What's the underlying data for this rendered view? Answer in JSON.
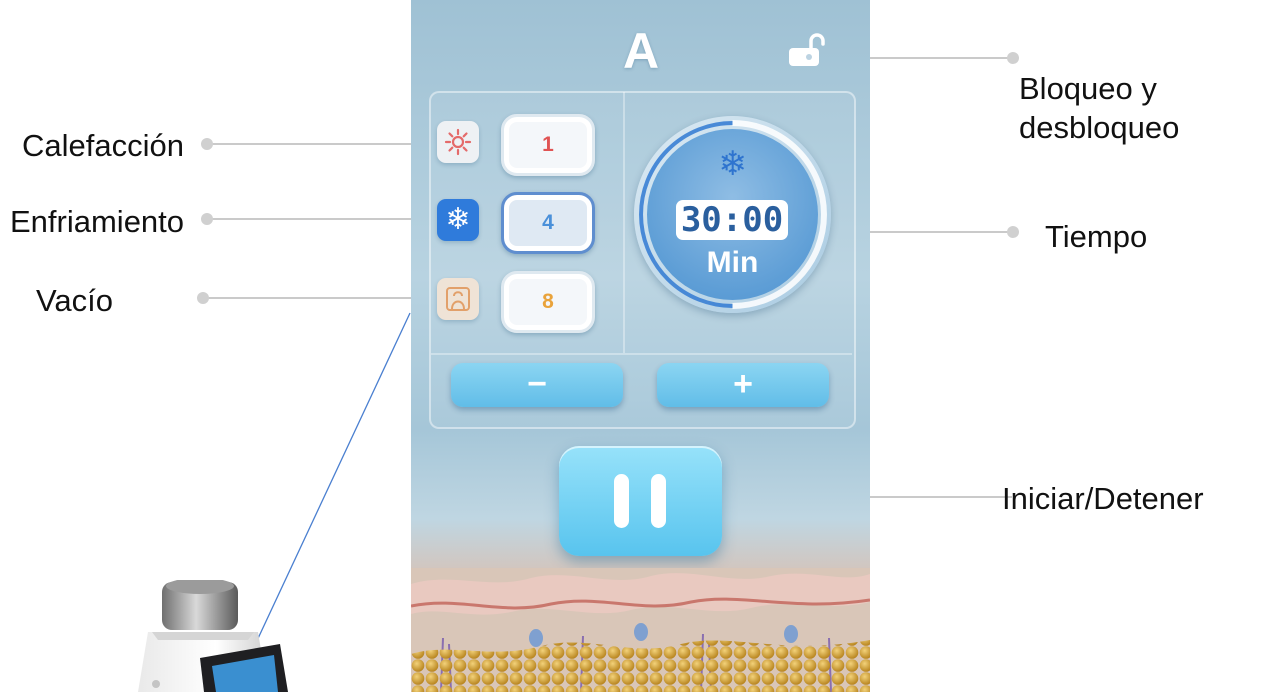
{
  "screen": {
    "preset_letter": "A",
    "modes": [
      {
        "name": "heating",
        "icon": "sun-icon",
        "level": "1",
        "color": "#e05353"
      },
      {
        "name": "cooling",
        "icon": "snowflake-icon",
        "level": "4",
        "color": "#4a90d9",
        "active": true
      },
      {
        "name": "vacuum",
        "icon": "vacuum-icon",
        "level": "8",
        "color": "#e9a33b"
      }
    ],
    "timer": {
      "icon": "snowflake-icon",
      "value": "30:00",
      "unit": "Min"
    },
    "minus_label": "−",
    "plus_label": "+",
    "play_state": "pause-icon",
    "lock_icon": "unlock-icon"
  },
  "callouts": {
    "lock": "Bloqueo y desbloqueo",
    "heating": "Calefacción",
    "cooling": "Enfriamiento",
    "time": "Tiempo",
    "vacuum": "Vacío",
    "start_stop": "Iniciar/Detener"
  },
  "colors": {
    "accent_cool": "#2f7bdb",
    "button_blue": "#61bde8",
    "heat": "#e05353",
    "vacuum": "#e9a33b"
  }
}
